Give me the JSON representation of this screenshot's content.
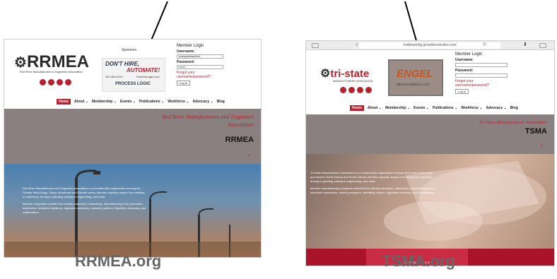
{
  "left": {
    "logo": "RRMEA",
    "logo_sub": "Red River Manufacturers & Engineers Association",
    "sponsors_label": "Sponsors",
    "ad": {
      "line1": "DON'T HIRE,",
      "line2": "AUTOMATE!",
      "phone": "320-484-9312",
      "web": "ProcessLogic.com",
      "brand": "PROCESS LOGIC"
    },
    "login": {
      "title": "Member Login",
      "username_label": "Username:",
      "username_value": "rrmeaphtelesmifind",
      "password_label": "Password:",
      "password_value": "••••••••",
      "forgot": "Forgot your username/password?",
      "button": "Log In"
    },
    "nav": [
      "Home",
      "About ⌄",
      "Membership ⌄",
      "Events ⌄",
      "Publications ⌄",
      "Workforce ⌄",
      "Advocacy ⌄",
      "Blog"
    ],
    "org_name": "Red River Manufacturers and Engineers Association",
    "org_abbr": "RRMEA",
    "para1": "Red River Manufacturers and Engineers Association is a membership organization serving the Greater West Fargo, Fargo, Moorhead and Dilworth areas. Member capacity ranges from welding to machining, turning to grinding, plating to engineering, and more.",
    "para2": "Member companies benefit from industry education, networking, manufacturing tours, job/career awareness, workforce initiatives, legislative advocacy, marketing options, legislative advocacy, and collaboration."
  },
  "right": {
    "url": "midwestmfg.growthzonesites.com",
    "logo": "tri-state",
    "logo_sub": "MANUFACTURERS' ASSOCIATION",
    "ad": {
      "line1": "ENGEL",
      "line2": "METALLURGICAL LTD"
    },
    "login": {
      "title": "Member Login",
      "username_label": "Username:",
      "password_label": "Password:",
      "forgot": "Forgot your username/password?",
      "button": "Log In"
    },
    "nav": [
      "Home",
      "About ⌄",
      "Membership ⌄",
      "Events ⌄",
      "Publications ⌄",
      "Workforce ⌄",
      "Advocacy ⌄",
      "Blog"
    ],
    "org_name": "Tri-State Manufacturers' Association",
    "org_abbr": "TSMA",
    "para1": "Tri-State Manufacturers' Association is a membership organization serving west central Minnesota and eastern North Dakota and South Dakota. Member capacity ranges from welding to machining, turning to grinding, plating to engineering, and more.",
    "para2": "Member manufacturing companies benefit from industry education, networking, manufacturing tours, job/career awareness, training programs, marketing options, legislative advocacy, and collaboration.",
    "mission": "OUR MISSION"
  },
  "captions": {
    "left": "RRMEA.org",
    "right": "TSMA.org"
  },
  "colors": {
    "brand_red": "#b8202d",
    "band_gray": "#8b8080",
    "caption_gray": "#666666"
  }
}
